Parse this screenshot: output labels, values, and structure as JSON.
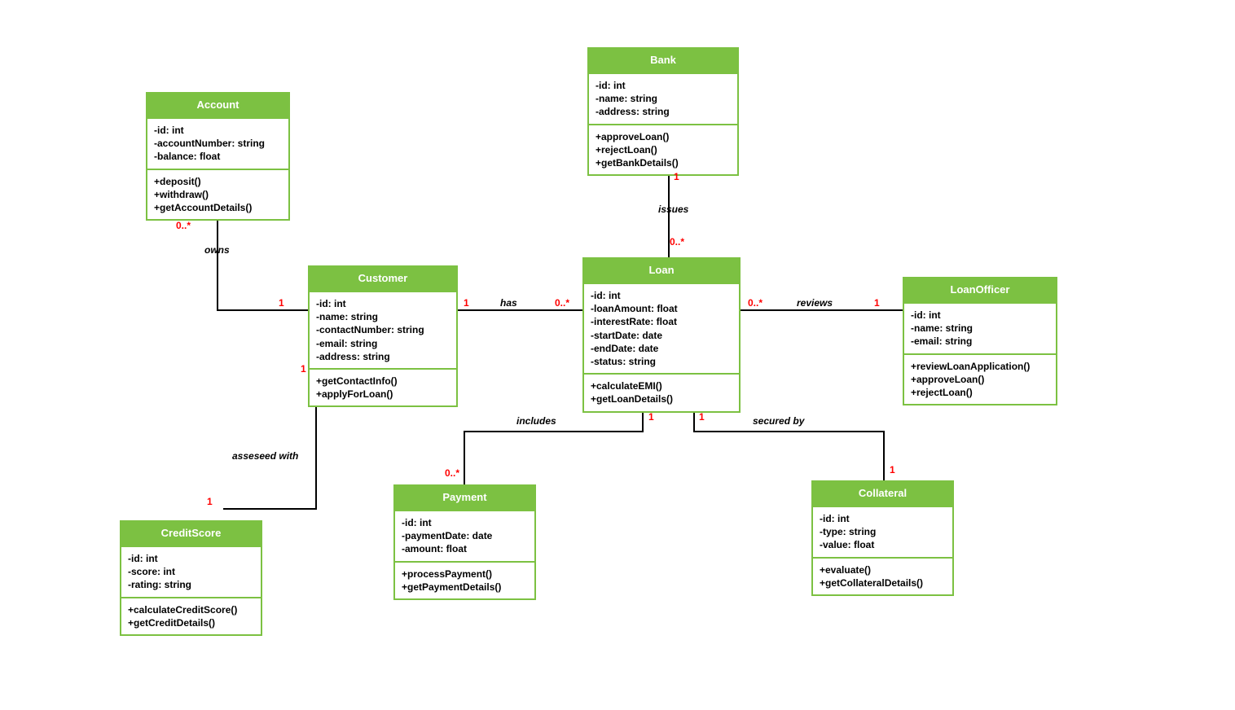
{
  "classes": {
    "account": {
      "name": "Account",
      "attrs": [
        "-id: int",
        "-accountNumber: string",
        "-balance: float"
      ],
      "ops": [
        "+deposit()",
        "+withdraw()",
        "+getAccountDetails()"
      ]
    },
    "customer": {
      "name": "Customer",
      "attrs": [
        "-id: int",
        "-name: string",
        "-contactNumber: string",
        "-email: string",
        "-address: string"
      ],
      "ops": [
        "+getContactInfo()",
        "+applyForLoan()"
      ]
    },
    "bank": {
      "name": "Bank",
      "attrs": [
        "-id: int",
        "-name: string",
        "-address: string"
      ],
      "ops": [
        "+approveLoan()",
        "+rejectLoan()",
        "+getBankDetails()"
      ]
    },
    "loan": {
      "name": "Loan",
      "attrs": [
        "-id: int",
        "-loanAmount: float",
        "-interestRate: float",
        "-startDate: date",
        "-endDate: date",
        "-status: string"
      ],
      "ops": [
        "+calculateEMI()",
        "+getLoanDetails()"
      ]
    },
    "loanofficer": {
      "name": "LoanOfficer",
      "attrs": [
        "-id: int",
        "-name: string",
        "-email: string"
      ],
      "ops": [
        "+reviewLoanApplication()",
        "+approveLoan()",
        "+rejectLoan()"
      ]
    },
    "creditscore": {
      "name": "CreditScore",
      "attrs": [
        "-id: int",
        "-score: int",
        "-rating: string"
      ],
      "ops": [
        "+calculateCreditScore()",
        "+getCreditDetails()"
      ]
    },
    "payment": {
      "name": "Payment",
      "attrs": [
        "-id: int",
        "-paymentDate: date",
        "-amount: float"
      ],
      "ops": [
        "+processPayment()",
        "+getPaymentDetails()"
      ]
    },
    "collateral": {
      "name": "Collateral",
      "attrs": [
        "-id: int",
        "-type: string",
        "-value: float"
      ],
      "ops": [
        "+evaluate()",
        "+getCollateralDetails()"
      ]
    }
  },
  "relations": {
    "owns": {
      "label": "owns",
      "m1": "0..*",
      "m2": "1"
    },
    "assessed": {
      "label": "asseseed with",
      "m1": "1",
      "m2": "1"
    },
    "has": {
      "label": "has",
      "m1": "1",
      "m2": "0..*"
    },
    "issues": {
      "label": "issues",
      "m1": "1",
      "m2": "0..*"
    },
    "reviews": {
      "label": "reviews",
      "m1": "0..*",
      "m2": "1"
    },
    "includes": {
      "label": "includes",
      "m1": "1",
      "m2": "0..*"
    },
    "securedby": {
      "label": "secured by",
      "m1": "1",
      "m2": "1"
    }
  }
}
